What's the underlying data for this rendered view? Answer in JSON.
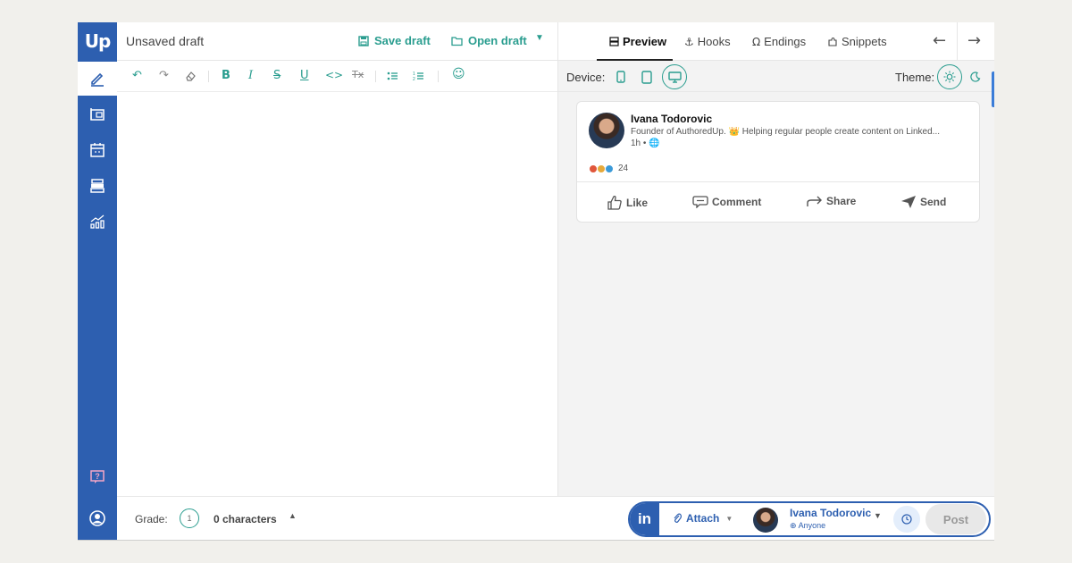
{
  "sidebar": {
    "logo": "Up",
    "items": [
      {
        "icon": "pencil-icon",
        "active": true
      },
      {
        "icon": "library-icon",
        "active": false
      },
      {
        "icon": "calendar-icon",
        "active": false
      },
      {
        "icon": "archive-icon",
        "active": false
      },
      {
        "icon": "analytics-icon",
        "active": false
      }
    ],
    "help_icon": "help-icon",
    "profile_icon": "profile-icon",
    "color": "#2d5fb0"
  },
  "header": {
    "draft_title": "Unsaved draft",
    "save_draft": "Save draft",
    "open_draft": "Open draft",
    "tabs": [
      {
        "label": "Preview",
        "icon": "preview-icon",
        "active": true
      },
      {
        "label": "Hooks",
        "icon": "anchor-icon",
        "active": false
      },
      {
        "label": "Endings",
        "icon": "omega-icon",
        "active": false
      },
      {
        "label": "Snippets",
        "icon": "puzzle-icon",
        "active": false
      }
    ]
  },
  "toolbar": {
    "tools": [
      "undo-icon",
      "redo-icon",
      "eraser-icon",
      "bold-icon",
      "italic-icon",
      "strikethrough-icon",
      "underline-icon",
      "code-icon",
      "clear-format-icon",
      "bullet-list-icon",
      "numbered-list-icon",
      "emoji-icon"
    ],
    "glyphs": {
      "undo": "↶",
      "redo": "↷",
      "bold": "B",
      "italic": "I",
      "strike": "S",
      "underline": "U",
      "code": "<>",
      "clear": "Tx",
      "emoji": "☺"
    }
  },
  "preview": {
    "device_label": "Device:",
    "devices": [
      "mobile-icon",
      "tablet-icon",
      "desktop-icon"
    ],
    "active_device": "desktop",
    "theme_label": "Theme:",
    "themes": [
      "sun-icon",
      "moon-icon"
    ],
    "active_theme": "light",
    "card": {
      "name": "Ivana Todorovic",
      "headline": "Founder of AuthoredUp. 👑 Helping regular people create content on Linked...",
      "meta": "1h • 🌐",
      "reaction_count": "24",
      "actions": [
        "Like",
        "Comment",
        "Share",
        "Send"
      ]
    }
  },
  "footer": {
    "grade_label": "Grade:",
    "grade_value": "1",
    "char_count": "0 characters",
    "li_label": "in",
    "attach_label": "Attach",
    "account_name": "Ivana Todorovic",
    "account_visibility": "Anyone",
    "post_label": "Post"
  },
  "colors": {
    "accent": "#2a9d8f",
    "brand": "#2d5fb0"
  }
}
